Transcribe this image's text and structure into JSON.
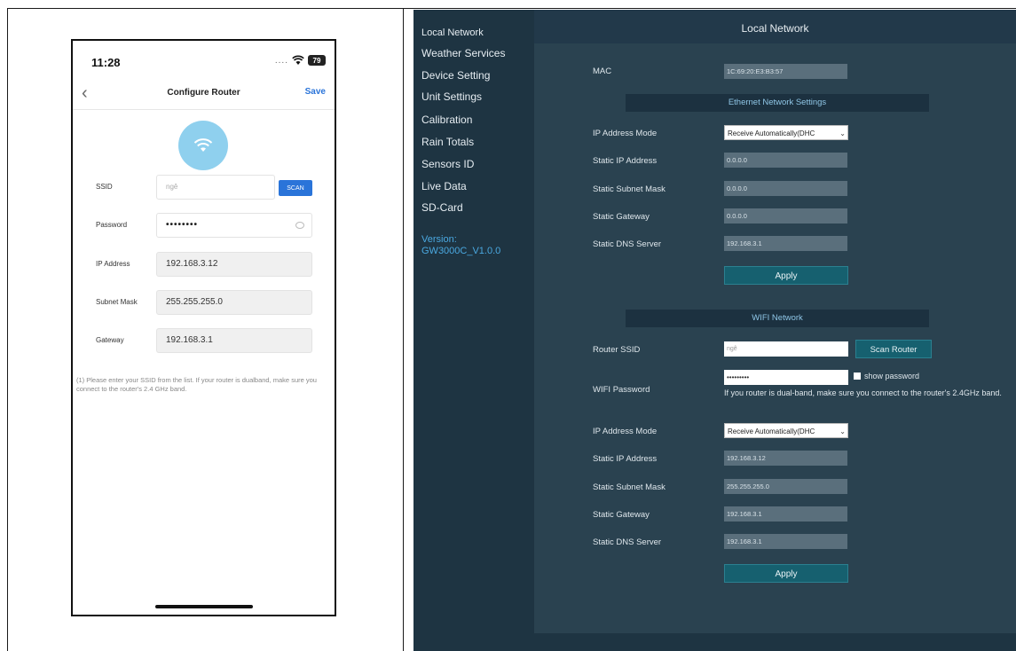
{
  "phone": {
    "status_time": "11:28",
    "status_dots": "....",
    "battery": "79",
    "nav_title": "Configure Router",
    "save_label": "Save",
    "fields": {
      "ssid": {
        "label": "SSID",
        "value": "ngê",
        "scan_label": "SCAN"
      },
      "password": {
        "label": "Password",
        "value": "••••••••"
      },
      "ip": {
        "label": "IP Address",
        "value": "192.168.3.12"
      },
      "subnet": {
        "label": "Subnet Mask",
        "value": "255.255.255.0"
      },
      "gateway": {
        "label": "Gateway",
        "value": "192.168.3.1"
      }
    },
    "note": "(1) Please enter your SSID from the list. If your router is dualband, make sure you connect to the router's 2.4 GHz band.",
    "accent_color": "#2a74d9"
  },
  "web": {
    "sidebar": {
      "items": [
        "Local Network",
        "Weather Services",
        "Device Setting",
        "Unit Settings",
        "Calibration",
        "Rain Totals",
        "Sensors ID",
        "Live Data",
        "SD-Card"
      ],
      "version_label": "Version:",
      "version_value": "GW3000C_V1.0.0"
    },
    "title": "Local Network",
    "mac": {
      "label": "MAC",
      "value": "1C:69:20:E3:B3:57"
    },
    "ethernet": {
      "section": "Ethernet Network Settings",
      "ip_mode": {
        "label": "IP Address Mode",
        "value": "Receive Automatically(DHC"
      },
      "static_ip": {
        "label": "Static IP Address",
        "value": "0.0.0.0"
      },
      "subnet": {
        "label": "Static Subnet Mask",
        "value": "0.0.0.0"
      },
      "gateway": {
        "label": "Static Gateway",
        "value": "0.0.0.0"
      },
      "dns": {
        "label": "Static DNS Server",
        "value": "192.168.3.1"
      },
      "apply": "Apply"
    },
    "wifi": {
      "section": "WIFI Network",
      "router_ssid": {
        "label": "Router SSID",
        "value": "ngê"
      },
      "scan_router": "Scan Router",
      "password": {
        "label": "WIFI Password",
        "value": "•••••••••",
        "show_password": "show password",
        "hint": "If you router is dual-band, make sure you connect to the router's 2.4GHz band."
      },
      "ip_mode": {
        "label": "IP Address Mode",
        "value": "Receive Automatically(DHC"
      },
      "static_ip": {
        "label": "Static IP Address",
        "value": "192.168.3.12"
      },
      "subnet": {
        "label": "Static Subnet Mask",
        "value": "255.255.255.0"
      },
      "gateway": {
        "label": "Static Gateway",
        "value": "192.168.3.1"
      },
      "dns": {
        "label": "Static DNS Server",
        "value": "192.168.3.1"
      },
      "apply": "Apply"
    }
  }
}
